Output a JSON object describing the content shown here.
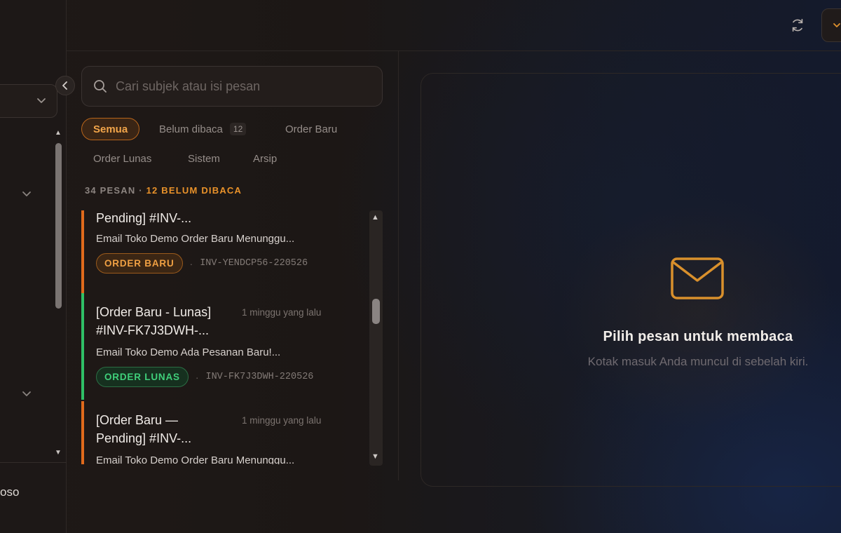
{
  "sidebar": {
    "user_partial": "oso"
  },
  "search": {
    "placeholder": "Cari subjek atau isi pesan"
  },
  "filters": [
    {
      "label": "Semua",
      "active": true
    },
    {
      "label": "Belum dibaca",
      "count": "12"
    },
    {
      "label": "Order Baru"
    },
    {
      "label": "Order Lunas"
    },
    {
      "label": "Sistem"
    },
    {
      "label": "Arsip"
    }
  ],
  "summary": {
    "total": "34 PESAN",
    "separator": "·",
    "unread": "12 BELUM DIBACA"
  },
  "messages": [
    {
      "title": "Pending] #INV-...",
      "time": "",
      "preview": "Email Toko Demo Order Baru Menunggu...",
      "tag": "ORDER BARU",
      "invoice": "INV-YENDCP56-220526",
      "accent": "#e06a1c"
    },
    {
      "title_line1": "[Order Baru - Lunas]",
      "title_line2": "#INV-FK7J3DWH-...",
      "time": "1 minggu yang lalu",
      "preview": "Email Toko Demo Ada Pesanan Baru!...",
      "tag": "ORDER LUNAS",
      "invoice": "INV-FK7J3DWH-220526",
      "accent": "#2fbf66"
    },
    {
      "title_line1": "[Order Baru —",
      "title_line2": "Pending] #INV-...",
      "time": "1 minggu yang lalu",
      "preview": "Email Toko Demo Order Baru Menunggu...",
      "accent": "#e06a1c"
    }
  ],
  "reading_pane": {
    "empty_title": "Pilih pesan untuk membaca",
    "empty_subtitle": "Kotak masuk Anda muncul di sebelah kiri."
  },
  "colors": {
    "accent_orange": "#f0a043",
    "accent_green": "#3fcf7a",
    "envelope": "#d9902c"
  }
}
